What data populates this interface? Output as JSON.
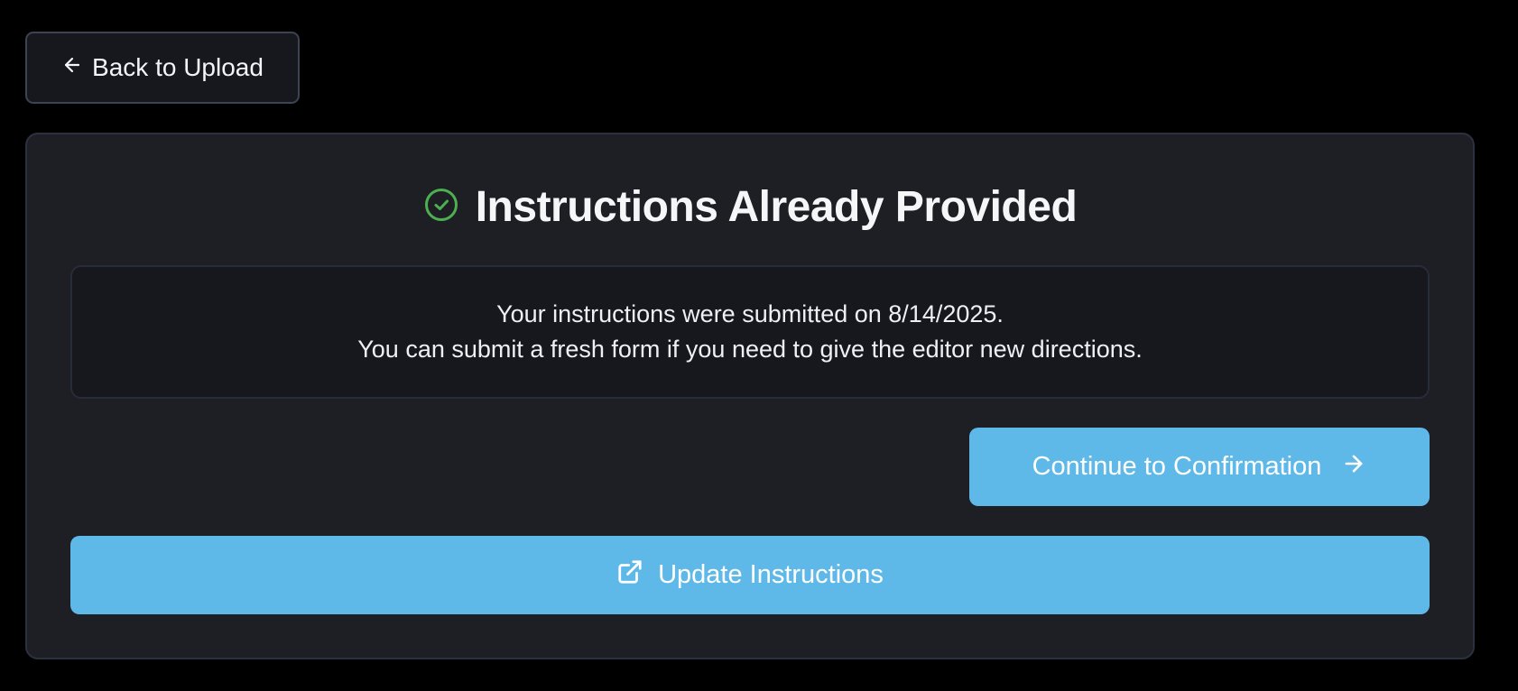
{
  "back_button": {
    "label": "Back to Upload",
    "icon": "arrow-left-icon"
  },
  "card": {
    "title": "Instructions Already Provided",
    "title_icon": "check-circle-icon",
    "info": {
      "line1": "Your instructions were submitted on 8/14/2025.",
      "line2": "You can submit a fresh form if you need to give the editor new directions."
    },
    "continue_button": {
      "label": "Continue to Confirmation",
      "icon": "arrow-right-icon"
    },
    "update_button": {
      "label": "Update Instructions",
      "icon": "external-link-icon"
    }
  },
  "colors": {
    "background": "#000000",
    "card": "#1e1f24",
    "accent": "#5fb9e8",
    "success": "#4caf50"
  }
}
